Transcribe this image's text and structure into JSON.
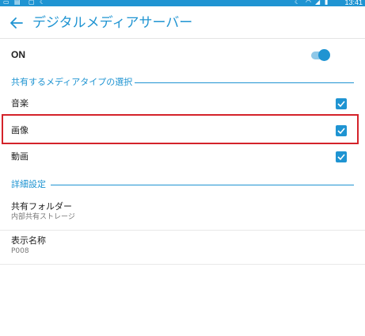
{
  "status_bar": {
    "time": "13:41",
    "icons": [
      "screenshot-icon",
      "sd-card-icon",
      "image-icon",
      "moon-icon",
      "moon-icon",
      "wifi-icon",
      "signal-icon",
      "battery-icon"
    ]
  },
  "app_bar": {
    "title": "デジタルメディアサーバー",
    "back_icon": "arrow-left-icon"
  },
  "master_switch": {
    "label": "ON",
    "enabled": true
  },
  "media_section": {
    "title": "共有するメディアタイプの選択",
    "items": [
      {
        "label": "音楽",
        "checked": true
      },
      {
        "label": "画像",
        "checked": true
      },
      {
        "label": "動画",
        "checked": true
      }
    ]
  },
  "detail_section": {
    "title": "詳細設定",
    "items": [
      {
        "label": "共有フォルダー",
        "value": "内部共有ストレージ"
      },
      {
        "label": "表示名称",
        "value": "P008"
      }
    ]
  },
  "colors": {
    "accent": "#1f94d2",
    "highlight": "#d4232a"
  }
}
